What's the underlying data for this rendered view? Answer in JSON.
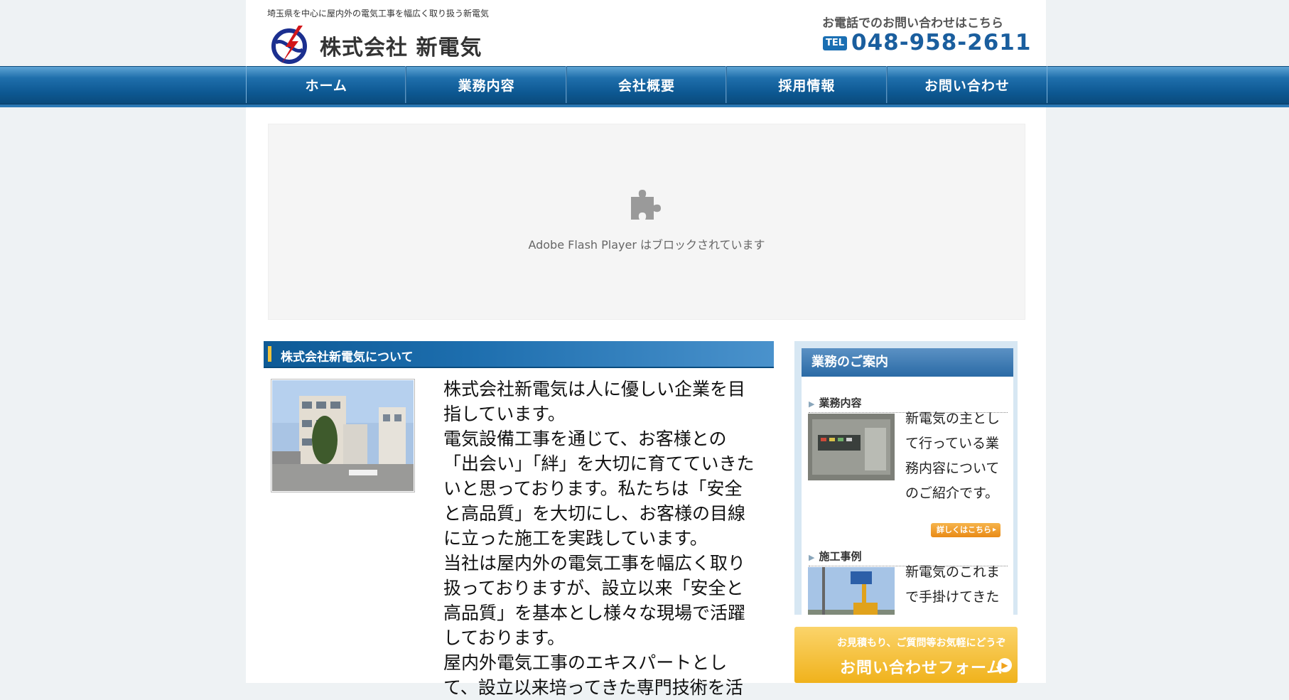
{
  "header": {
    "tagline": "埼玉県を中心に屋内外の電気工事を幅広く取り扱う新電気",
    "company_name": "株式会社 新電気",
    "contact_label": "お電話でのお問い合わせはこちら",
    "tel_badge": "TEL",
    "tel_number": "048-958-2611"
  },
  "nav": {
    "items": [
      {
        "label": "ホーム"
      },
      {
        "label": "業務内容"
      },
      {
        "label": "会社概要"
      },
      {
        "label": "採用情報"
      },
      {
        "label": "お問い合わせ"
      }
    ]
  },
  "flash": {
    "message": "Adobe Flash Player はブロックされています",
    "icon": "puzzle-icon"
  },
  "main": {
    "heading": "株式会社新電気について",
    "paragraphs": [
      "株式会社新電気は人に優しい企業を目指しています。",
      "電気設備工事を通じて、お客様との「出会い」「絆」を大切に育てていきたいと思っております。私たちは「安全と高品質」を大切にし、お客様の目線に立った施工を実践しています。",
      "当社は屋内外の電気工事を幅広く取り扱っておりますが、設立以来「安全と高品質」を基本とし様々な現場で活躍しております。",
      "屋内外電気工事のエキスパートとして、設立以来培ってきた専門技術を活"
    ]
  },
  "sidebar": {
    "title": "業務のご案内",
    "sections": [
      {
        "heading": "業務内容",
        "text": "新電気の主として行っている業務内容についてのご紹介です。",
        "button": "詳しくはこちら"
      },
      {
        "heading": "施工事例",
        "text": "新電気のこれまで手掛けてきた施工実績をご紹"
      }
    ]
  },
  "contact_banner": {
    "small": "お見積もり、ご質問等お気軽にどうぞ",
    "big": "お問い合わせフォーム"
  },
  "colors": {
    "nav_blue": "#0d5892",
    "accent_orange": "#f0b21c",
    "tel_blue": "#1a5e9e"
  }
}
